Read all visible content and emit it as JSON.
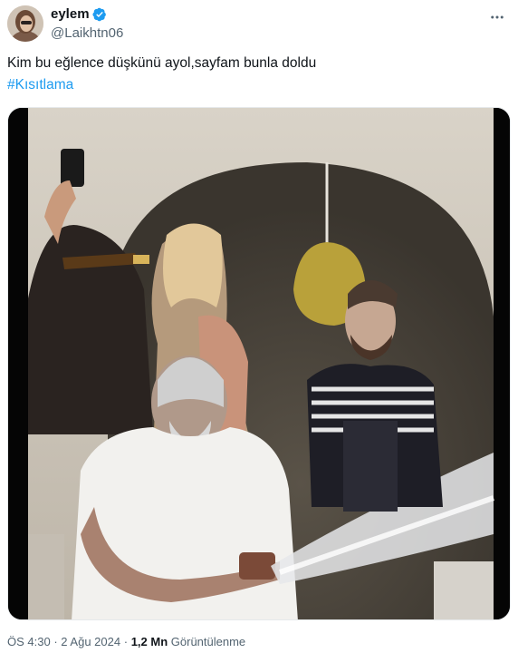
{
  "author": {
    "display_name": "eylem",
    "handle": "@Laikhtn06",
    "verified": true,
    "avatar_icon": "profile-photo",
    "verified_icon": "verified-badge-icon"
  },
  "tweet": {
    "text": "Kim bu eğlence düşkünü ayol,sayfam bunla doldu",
    "hashtag": "#Kısıtlama"
  },
  "media": {
    "type": "video",
    "description_icon": "video-frame"
  },
  "meta": {
    "time": "ÖS 4:30",
    "separator": "·",
    "date": "2 Ağu 2024",
    "views_count": "1,2 Mn",
    "views_label": "Görüntülenme"
  },
  "colors": {
    "accent": "#1d9bf0",
    "text_primary": "#0f1419",
    "text_secondary": "#536471"
  }
}
